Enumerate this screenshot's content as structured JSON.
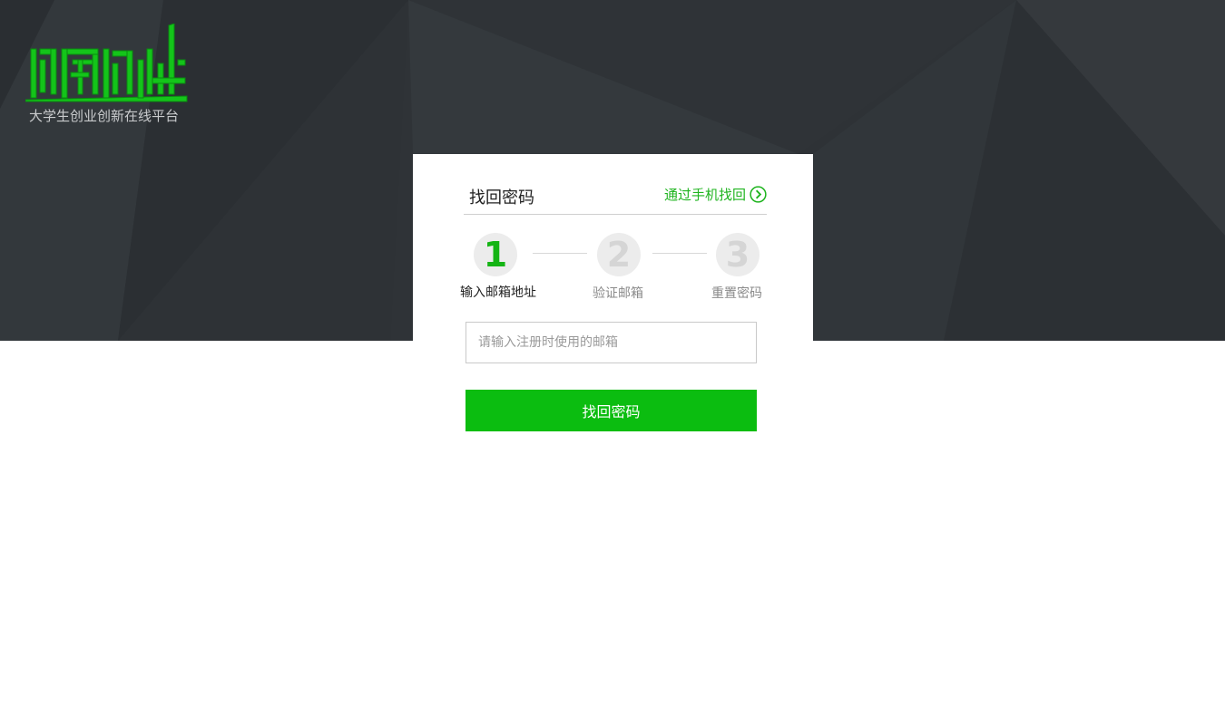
{
  "brand": {
    "logo_text": "创新创业",
    "slogan": "大学生创业创新在线平台",
    "accent_color": "#0bbd10"
  },
  "form": {
    "title": "找回密码",
    "phone_link": "通过手机找回",
    "steps": [
      {
        "number": "1",
        "label": "输入邮箱地址",
        "active": true
      },
      {
        "number": "2",
        "label": "验证邮箱",
        "active": false
      },
      {
        "number": "3",
        "label": "重置密码",
        "active": false
      }
    ],
    "email_placeholder": "请输入注册时使用的邮箱",
    "email_value": "",
    "submit_label": "找回密码"
  },
  "icons": {
    "phone_link_icon": "chevron-right-circle-icon",
    "logo_icon": "brand-logo-icon"
  }
}
